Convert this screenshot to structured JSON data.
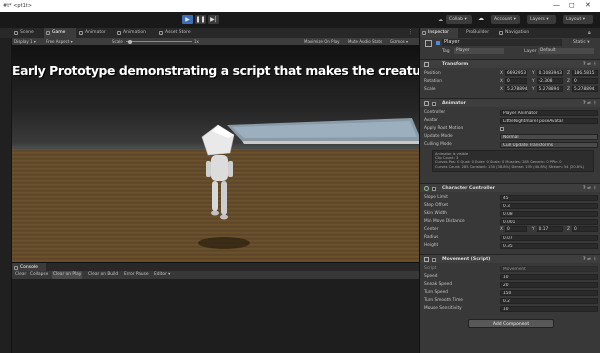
{
  "window": {
    "title": "#t* <pt1t>",
    "controls": [
      "—",
      "◻",
      "✕"
    ]
  },
  "toolbar": {
    "play_icon": "▶",
    "pause_icon": "❚❚",
    "step_icon": "▶|",
    "collab_label": "Collab ▾",
    "account_label": "Account ▾",
    "layers_label": "Layers ▾",
    "layout_label": "Layout ▾"
  },
  "tabs": [
    {
      "label": "Scene"
    },
    {
      "label": "Game"
    },
    {
      "label": "Animator"
    },
    {
      "label": "Animation"
    },
    {
      "label": "Asset Store"
    }
  ],
  "game_toolbar": {
    "display": "Display 1 ▾",
    "aspect": "Free Aspect ▾",
    "scale_label": "Scale",
    "scale_value": "1x",
    "maximize": "Maximize On Play",
    "mute": "Mute Audio",
    "stats": "Stats",
    "gizmos": "Gizmos ▾"
  },
  "viewport": {
    "banner": "Early Prototype demonstrating a script that makes the creature move to target"
  },
  "console": {
    "tab_label": "Console",
    "clear": "Clear",
    "collapse": "Collapse",
    "clear_on_play": "Clear on Play",
    "clear_on_build": "Clear on Build",
    "error_pause": "Error Pause",
    "editor": "Editor ▾"
  },
  "inspector_tabs": [
    {
      "label": "Inspector"
    },
    {
      "label": "ProBuilder"
    },
    {
      "label": "Navigation"
    }
  ],
  "inspector": {
    "object_name": "Player",
    "static_label": "Static ▾",
    "tag_label": "Tag",
    "tag_value": "Player",
    "layer_label": "Layer",
    "layer_value": "Default",
    "transform": {
      "title": "Transform",
      "position_label": "Position",
      "position": [
        "6692953",
        "0.1083943",
        "186.5815"
      ],
      "rotation_label": "Rotation",
      "rotation": [
        "0",
        "-2.308",
        "0"
      ],
      "scale_label": "Scale",
      "scale": [
        "5.278894",
        "5.278894",
        "5.278894"
      ]
    },
    "animator": {
      "title": "Animator",
      "controller_label": "Controller",
      "controller_value": "Player Animator",
      "avatar_label": "Avatar",
      "avatar_value": "LittleNightmareTposeAvatar",
      "root_motion_label": "Apply Root Motion",
      "update_mode_label": "Update Mode",
      "update_mode_value": "Normal",
      "culling_mode_label": "Culling Mode",
      "culling_mode_value": "Cull Update Transforms",
      "info": "Animator is visible\nClip Count: 3\nCurves Pos: 0 Quat: 0 Euler: 0 Scale: 0 Muscles: 285 Generic: 0 PPtr: 0\nCurves Count: 285 Constant: 150 (38.8%) Dense: 195 (40.8%) Stream: 54 (20.8%)"
    },
    "character_controller": {
      "title": "Character Controller",
      "slope_label": "Slope Limit",
      "slope_value": "45",
      "step_label": "Step Offset",
      "step_value": "0.3",
      "skin_label": "Skin Width",
      "skin_value": "0.08",
      "min_move_label": "Min Move Distance",
      "min_move_value": "0.001",
      "center_label": "Center",
      "center": [
        "0",
        "0.17",
        "0"
      ],
      "radius_label": "Radius",
      "radius_value": "0.07",
      "height_label": "Height",
      "height_value": "0.35"
    },
    "movement": {
      "title": "Movement (Script)",
      "script_label": "Script",
      "script_value": "Movement",
      "speed_label": "Speed",
      "speed_value": "10",
      "sneak_label": "Sneak Speed",
      "sneak_value": "20",
      "turn_label": "Turn Speed",
      "turn_value": "150",
      "turn_smooth_label": "Turn Smooth Time",
      "turn_smooth_value": "0.2",
      "mouse_label": "Mouse Sensitivity",
      "mouse_value": "10"
    },
    "add_component": "Add Component"
  },
  "colors": {
    "play_active": "#3d6fb6",
    "panel_bg": "#383838",
    "toolbar_bg": "#191919",
    "ground": "#6a5130"
  }
}
